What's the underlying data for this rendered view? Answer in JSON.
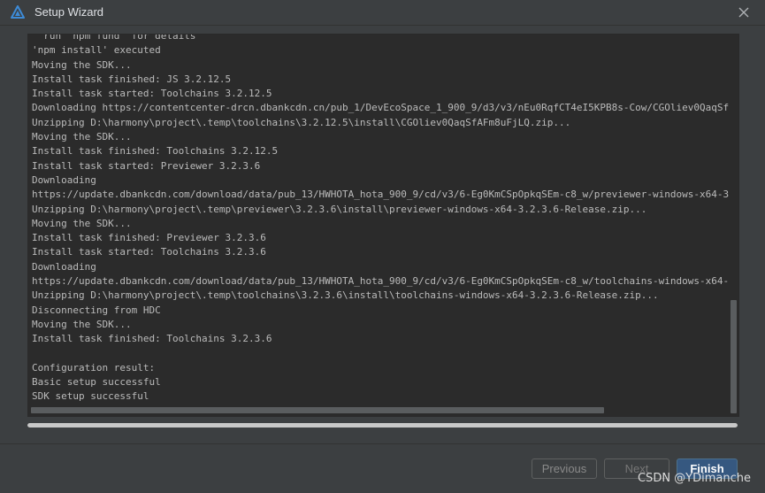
{
  "window": {
    "title": "Setup Wizard"
  },
  "console": {
    "lines": [
      "  run  npm fund  for details",
      "'npm install' executed",
      "Moving the SDK...",
      "Install task finished: JS 3.2.12.5",
      "Install task started: Toolchains 3.2.12.5",
      "Downloading https://contentcenter-drcn.dbankcdn.cn/pub_1/DevEcoSpace_1_900_9/d3/v3/nEu0RqfCT4eI5KPB8s-Cow/CGOliev0QaqSf",
      "Unzipping D:\\harmony\\project\\.temp\\toolchains\\3.2.12.5\\install\\CGOliev0QaqSfAFm8uFjLQ.zip...",
      "Moving the SDK...",
      "Install task finished: Toolchains 3.2.12.5",
      "Install task started: Previewer 3.2.3.6",
      "Downloading",
      "https://update.dbankcdn.com/download/data/pub_13/HWHOTA_hota_900_9/cd/v3/6-Eg0KmCSpOpkqSEm-c8_w/previewer-windows-x64-3",
      "Unzipping D:\\harmony\\project\\.temp\\previewer\\3.2.3.6\\install\\previewer-windows-x64-3.2.3.6-Release.zip...",
      "Moving the SDK...",
      "Install task finished: Previewer 3.2.3.6",
      "Install task started: Toolchains 3.2.3.6",
      "Downloading",
      "https://update.dbankcdn.com/download/data/pub_13/HWHOTA_hota_900_9/cd/v3/6-Eg0KmCSpOpkqSEm-c8_w/toolchains-windows-x64-",
      "Unzipping D:\\harmony\\project\\.temp\\toolchains\\3.2.3.6\\install\\toolchains-windows-x64-3.2.3.6-Release.zip...",
      "Disconnecting from HDC",
      "Moving the SDK...",
      "Install task finished: Toolchains 3.2.3.6",
      "",
      "Configuration result:",
      "Basic setup successful",
      "SDK setup successful"
    ]
  },
  "progress": {
    "value_percent": 100
  },
  "buttons": {
    "previous_label": "Previous",
    "next_label": "Next",
    "finish_label": "Finish"
  },
  "watermark": {
    "text": "CSDN @YDimanche"
  },
  "colors": {
    "background": "#3c3f41",
    "console_bg": "#2b2b2b",
    "console_text": "#bbbbbb",
    "accent": "#365880",
    "app_icon": "#3d8bd7"
  },
  "icons": {
    "app": "deveco-logo-icon",
    "close": "close-icon"
  }
}
